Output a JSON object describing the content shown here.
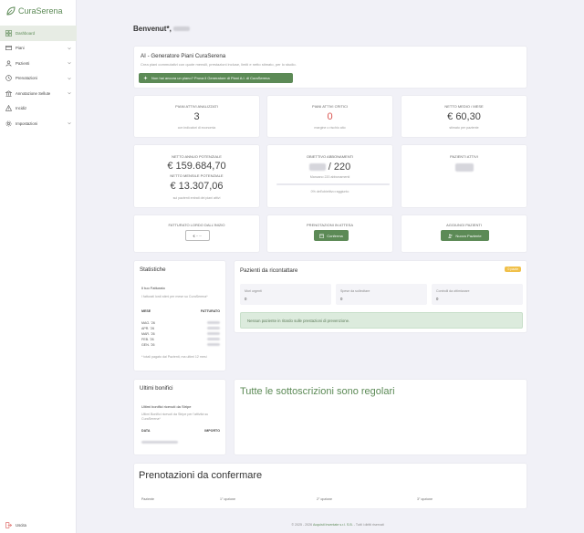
{
  "app": {
    "brand": "CuraSerena"
  },
  "sidebar": {
    "items": [
      {
        "label": "Dashboard",
        "icon": "dashboard-icon"
      },
      {
        "label": "Piani",
        "icon": "card-icon"
      },
      {
        "label": "Pazienti",
        "icon": "user-icon"
      },
      {
        "label": "Prenotazioni",
        "icon": "clock-icon"
      },
      {
        "label": "Annotazione Sellute",
        "icon": "bank-icon"
      },
      {
        "label": "Incidiz",
        "icon": "alert-icon"
      },
      {
        "label": "Impostazioni",
        "icon": "gear-icon"
      }
    ],
    "logout": "Uscita"
  },
  "header": {
    "welcome": "Benvenut*,"
  },
  "ai": {
    "title": "AI - Generatore Piani CuraSerena",
    "subtitle": "Crea piani commutativi con quote mensili, prestazioni incluse, limiti e netto stimato, per lo studio.",
    "button": "Non hai ancora un piano? Prova il Generatore di Piani A.I. di CuraSerena"
  },
  "stats": {
    "piani_attivi": {
      "label": "PIANI ATTIVI ANALIZZATI",
      "value": "3",
      "sub": "con indicatori di economia"
    },
    "piani_critici": {
      "label": "PIANI ATTIVI CRITICI",
      "value": "0",
      "sub": "margine o rischio alto"
    },
    "netto_medio": {
      "label": "NETTO MEDIO / MESE",
      "value": "€ 60,30",
      "sub": "stimato per paziente"
    },
    "netto_annuo": {
      "label": "NETTO ANNUO POTENZIALE",
      "value": "€ 159.684,70",
      "label2": "NETTO MENSILE POTENZIALE",
      "value2": "€ 13.307,06",
      "sub": "sui pazienti entrati dei piani attivi"
    },
    "obiettivo": {
      "label": "OBIETTIVO ABBONAMENTI",
      "value": "/ 220",
      "sub": "Mancano 220 abbonamenti",
      "sub2": "0% dell'obiettivo raggiunto",
      "progress": 0
    },
    "pazienti_attivi": {
      "label": "PAZIENTI ATTIVI"
    },
    "fatturato": {
      "label": "FATTURATO LORDO DALL'INIZIO",
      "button": "€ ·····"
    },
    "prenotazioni": {
      "label": "PRENOTAZIONI IN ATTESA",
      "button": "Conferma"
    },
    "aggiungi": {
      "label": "AGGIUNGI PAZIENTI",
      "button": "Nuovo Paziente"
    }
  },
  "statistiche": {
    "title": "Statistiche",
    "subtitle": "Il tuo Fatturato",
    "desc": "I fatturati lordi stimi per mese su CuraSerena*",
    "col_mese": "MESE",
    "col_fatturato": "FATTURATO",
    "rows": [
      "MAG. '26",
      "APR. '26",
      "MAR. '26",
      "FEB. '26",
      "GEN. '26"
    ],
    "note": "* totali pagato dai Pazienti, ma ultimi 12 mesi"
  },
  "ricontattare": {
    "title": "Pazienti da ricontattare",
    "badge": "0 pazie",
    "boxes": [
      {
        "label": "Mori urgenti",
        "value": "0"
      },
      {
        "label": "Spese da sollecitare",
        "value": "0"
      },
      {
        "label": "Controlli da ottimizzare",
        "value": "0"
      }
    ],
    "alert": "Nessun paziente in ritardo sulle prestazioni di prevenzione."
  },
  "bonifici": {
    "title": "Ultimi bonifici",
    "subtitle": "Ultimi bonifici ricevuti da Stripe",
    "desc": "Ultimi Bonifici ricevuti da Stripe per l'attività su CuraSerena*",
    "col_data": "DATA",
    "col_importo": "IMPORTO"
  },
  "sottoscrizioni": {
    "title": "Tutte le sottoscrizioni sono regolari"
  },
  "prenotazioni_conf": {
    "title": "Prenotazioni da confermare",
    "cols": [
      "Paziente",
      "1° opzione",
      "2° opzione",
      "3° opzione"
    ]
  },
  "footer": {
    "text": "© 2025 - 2026",
    "link": "Acquisti Inventate s.r.l. S.B.",
    "rest": "- Tutti i diritti riservati"
  },
  "colors": {
    "accent": "#5c8a56",
    "critical": "#d9534f",
    "badge": "#f0c04a"
  }
}
